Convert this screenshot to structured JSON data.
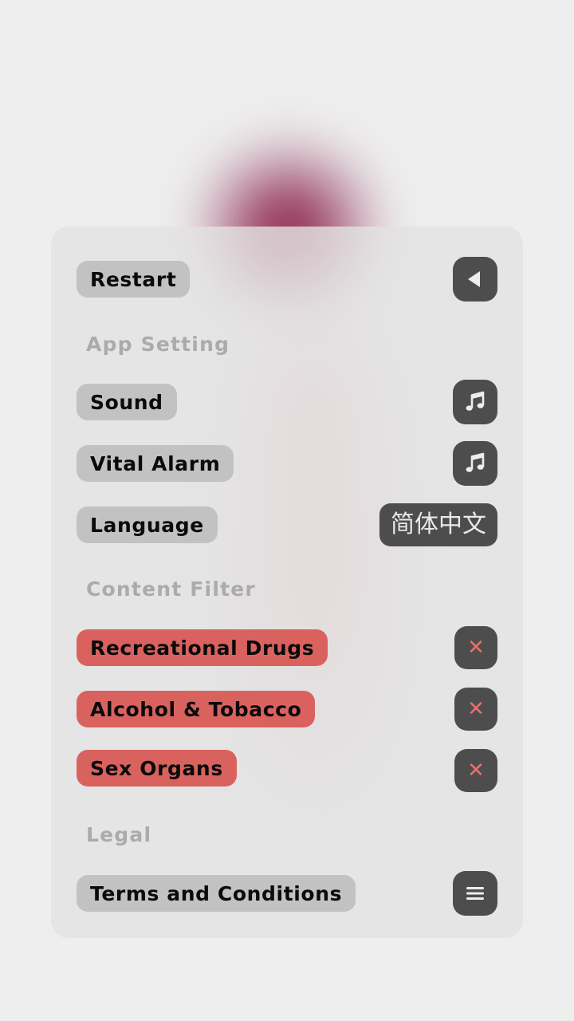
{
  "page": {
    "background_color": "#eeeeee",
    "panel_color": "#e2e2e2",
    "accent_red": "#d9625f",
    "pill_gray": "#c2c2c2",
    "icon_dark": "#4d4d4d",
    "section_label_color": "#ababab"
  },
  "panel": {
    "top_row": {
      "label": "Restart",
      "icon": "back-triangle-icon"
    },
    "sections": [
      {
        "title": "App Setting",
        "rows": [
          {
            "label": "Sound",
            "control": "icon",
            "icon": "music-note-icon",
            "value": ""
          },
          {
            "label": "Vital Alarm",
            "control": "icon",
            "icon": "music-note-icon",
            "value": ""
          },
          {
            "label": "Language",
            "control": "badge",
            "icon": "",
            "value": "简体中文"
          }
        ]
      },
      {
        "title": "Content Filter",
        "rows": [
          {
            "label": "Recreational Drugs",
            "control": "icon",
            "icon": "close-x-icon",
            "value": "",
            "state": "blocked"
          },
          {
            "label": "Alcohol & Tobacco",
            "control": "icon",
            "icon": "close-x-icon",
            "value": "",
            "state": "blocked"
          },
          {
            "label": "Sex Organs",
            "control": "icon",
            "icon": "close-x-icon",
            "value": "",
            "state": "blocked"
          }
        ]
      },
      {
        "title": "Legal",
        "rows": [
          {
            "label": "Terms and Conditions",
            "control": "icon",
            "icon": "hamburger-menu-icon",
            "value": ""
          }
        ]
      }
    ]
  }
}
